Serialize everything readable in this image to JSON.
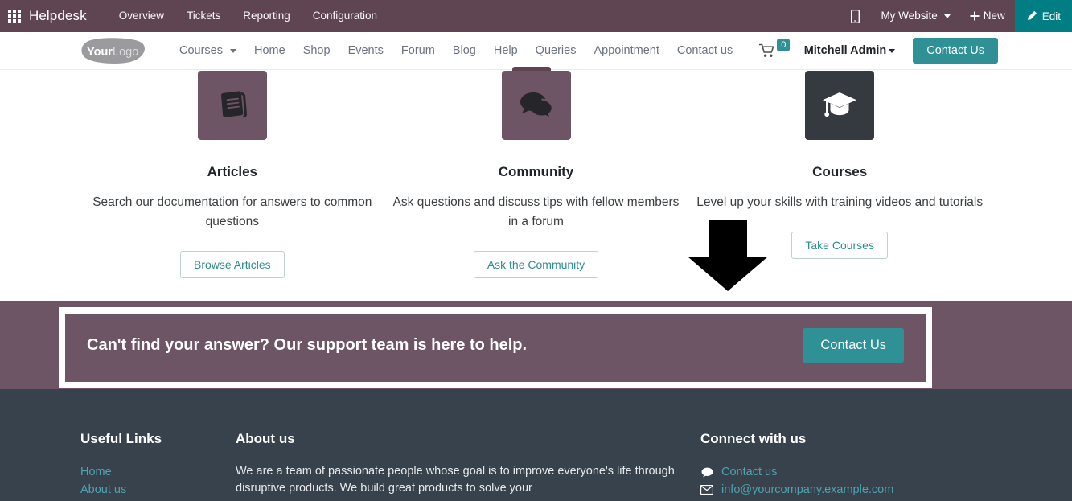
{
  "backend_bar": {
    "apps_icon": "apps-grid-icon",
    "app_name": "Helpdesk",
    "menu": [
      {
        "label": "Overview"
      },
      {
        "label": "Tickets"
      },
      {
        "label": "Reporting"
      },
      {
        "label": "Configuration"
      }
    ],
    "mobile_icon": "mobile-phone-icon",
    "website_selector": "My Website",
    "new_label": "New",
    "new_icon": "plus-icon",
    "edit_label": "Edit",
    "edit_icon": "pencil-icon",
    "bar_color": "#5f4452",
    "edit_button_color": "#017e84"
  },
  "site_nav": {
    "logo_primary": "Your",
    "logo_secondary": "Logo",
    "menu": [
      {
        "label": "Courses",
        "has_dropdown": true
      },
      {
        "label": "Home",
        "has_dropdown": false
      },
      {
        "label": "Shop",
        "has_dropdown": false
      },
      {
        "label": "Events",
        "has_dropdown": false
      },
      {
        "label": "Forum",
        "has_dropdown": false
      },
      {
        "label": "Blog",
        "has_dropdown": false
      },
      {
        "label": "Help",
        "has_dropdown": false
      },
      {
        "label": "Queries",
        "has_dropdown": false
      },
      {
        "label": "Appointment",
        "has_dropdown": false
      },
      {
        "label": "Contact us",
        "has_dropdown": false
      }
    ],
    "cart_icon": "shopping-cart-icon",
    "cart_count": "0",
    "user_name": "Mitchell Admin",
    "contact_button": "Contact Us",
    "accent_color": "#2f9196"
  },
  "cards": [
    {
      "icon": "book-icon",
      "icon_style": "mauve",
      "title": "Articles",
      "description": "Search our documentation for answers to common questions",
      "button": "Browse Articles"
    },
    {
      "icon": "comments-icon",
      "icon_style": "mauve",
      "title": "Community",
      "description": "Ask questions and discuss tips with fellow members in a forum",
      "button": "Ask the Community"
    },
    {
      "icon": "graduation-cap-icon",
      "icon_style": "dark",
      "title": "Courses",
      "description": "Level up your skills with training videos and tutorials",
      "button": "Take Courses"
    }
  ],
  "cta": {
    "text": "Can't find your answer? Our support team is here to help.",
    "button": "Contact Us",
    "band_color": "#6d5566",
    "highlight_color": "#ffffff"
  },
  "annotation": {
    "arrow": "down-arrow-annotation",
    "arrow_color": "#000000"
  },
  "footer": {
    "background": "#37424c",
    "link_color": "#4ea3b0",
    "useful_links": {
      "heading": "Useful Links",
      "items": [
        {
          "label": "Home"
        },
        {
          "label": "About us"
        }
      ]
    },
    "about": {
      "heading": "About us",
      "text": "We are a team of passionate people whose goal is to improve everyone's life through disruptive products. We build great products to solve your"
    },
    "connect": {
      "heading": "Connect with us",
      "items": [
        {
          "icon": "comment-icon",
          "label": "Contact us"
        },
        {
          "icon": "envelope-icon",
          "label": "info@yourcompany.example.com"
        }
      ]
    }
  }
}
